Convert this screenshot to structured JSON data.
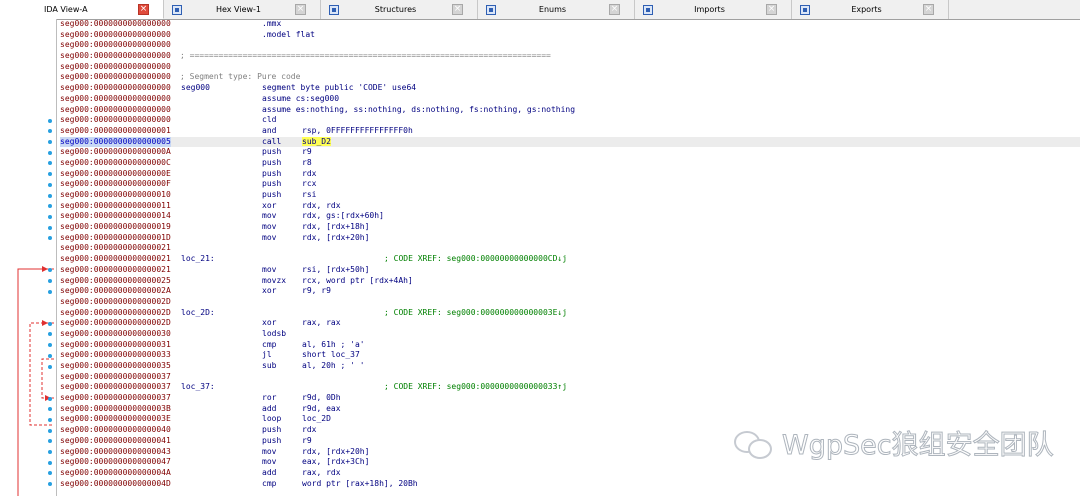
{
  "tabs": [
    {
      "label": "IDA View-A",
      "active": true,
      "icon": "ida-view-icon"
    },
    {
      "label": "Hex View-1",
      "active": false,
      "icon": "hex-view-icon"
    },
    {
      "label": "Structures",
      "active": false,
      "icon": "structures-icon"
    },
    {
      "label": "Enums",
      "active": false,
      "icon": "enums-icon"
    },
    {
      "label": "Imports",
      "active": false,
      "icon": "imports-icon"
    },
    {
      "label": "Exports",
      "active": false,
      "icon": "exports-icon"
    }
  ],
  "close_glyph": "×",
  "colors": {
    "address": "#800000",
    "instruction": "#000080",
    "xref": "#008000",
    "comment": "#808080",
    "highlight": "#ffff55",
    "arrow": "#e03030",
    "dot": "#27a0e0"
  },
  "listing": [
    {
      "addr": "seg000:0000000000000000",
      "label": "",
      "mn": ".mmx",
      "op": ""
    },
    {
      "addr": "seg000:0000000000000000",
      "label": "",
      "mn": ".model flat",
      "op": ""
    },
    {
      "addr": "seg000:0000000000000000",
      "label": "",
      "mn": "",
      "op": ""
    },
    {
      "addr": "seg000:0000000000000000",
      "comment": "; ===========================================================================",
      "mn": "",
      "op": ""
    },
    {
      "addr": "seg000:0000000000000000",
      "label": "",
      "mn": "",
      "op": ""
    },
    {
      "addr": "seg000:0000000000000000",
      "comment": "; Segment type: Pure code",
      "mn": "",
      "op": ""
    },
    {
      "addr": "seg000:0000000000000000",
      "label": "seg000",
      "mn": "segment byte public 'CODE' use64",
      "op": ""
    },
    {
      "addr": "seg000:0000000000000000",
      "label": "",
      "mn": "assume cs:seg000",
      "op": ""
    },
    {
      "addr": "seg000:0000000000000000",
      "label": "",
      "mn": "assume es:nothing, ss:nothing, ds:nothing, fs:nothing, gs:nothing",
      "op": ""
    },
    {
      "addr": "seg000:0000000000000000",
      "label": "",
      "mn": "cld",
      "op": "",
      "dot": true
    },
    {
      "addr": "seg000:0000000000000001",
      "label": "",
      "mn": "and",
      "op": "rsp, 0FFFFFFFFFFFFFFF0h",
      "dot": true
    },
    {
      "addr": "seg000:0000000000000005",
      "label": "",
      "mn": "call",
      "op": "sub_D2",
      "dot": true,
      "selected": true,
      "op_highlight": true
    },
    {
      "addr": "seg000:000000000000000A",
      "label": "",
      "mn": "push",
      "op": "r9",
      "dot": true
    },
    {
      "addr": "seg000:000000000000000C",
      "label": "",
      "mn": "push",
      "op": "r8",
      "dot": true
    },
    {
      "addr": "seg000:000000000000000E",
      "label": "",
      "mn": "push",
      "op": "rdx",
      "dot": true
    },
    {
      "addr": "seg000:000000000000000F",
      "label": "",
      "mn": "push",
      "op": "rcx",
      "dot": true
    },
    {
      "addr": "seg000:0000000000000010",
      "label": "",
      "mn": "push",
      "op": "rsi",
      "dot": true
    },
    {
      "addr": "seg000:0000000000000011",
      "label": "",
      "mn": "xor",
      "op": "rdx, rdx",
      "dot": true
    },
    {
      "addr": "seg000:0000000000000014",
      "label": "",
      "mn": "mov",
      "op": "rdx, gs:[rdx+60h]",
      "dot": true
    },
    {
      "addr": "seg000:0000000000000019",
      "label": "",
      "mn": "mov",
      "op": "rdx, [rdx+18h]",
      "dot": true
    },
    {
      "addr": "seg000:000000000000001D",
      "label": "",
      "mn": "mov",
      "op": "rdx, [rdx+20h]",
      "dot": true
    },
    {
      "addr": "seg000:0000000000000021",
      "label": "",
      "mn": "",
      "op": ""
    },
    {
      "addr": "seg000:0000000000000021",
      "label": "loc_21:",
      "mn": "",
      "op": "",
      "xref": "; CODE XREF: seg000:00000000000000CD↓j"
    },
    {
      "addr": "seg000:0000000000000021",
      "label": "",
      "mn": "mov",
      "op": "rsi, [rdx+50h]",
      "dot": true
    },
    {
      "addr": "seg000:0000000000000025",
      "label": "",
      "mn": "movzx",
      "op": "rcx, word ptr [rdx+4Ah]",
      "dot": true
    },
    {
      "addr": "seg000:000000000000002A",
      "label": "",
      "mn": "xor",
      "op": "r9, r9",
      "dot": true
    },
    {
      "addr": "seg000:000000000000002D",
      "label": "",
      "mn": "",
      "op": ""
    },
    {
      "addr": "seg000:000000000000002D",
      "label": "loc_2D:",
      "mn": "",
      "op": "",
      "xref": "; CODE XREF: seg000:000000000000003E↓j"
    },
    {
      "addr": "seg000:000000000000002D",
      "label": "",
      "mn": "xor",
      "op": "rax, rax",
      "dot": true
    },
    {
      "addr": "seg000:0000000000000030",
      "label": "",
      "mn": "lodsb",
      "op": "",
      "dot": true
    },
    {
      "addr": "seg000:0000000000000031",
      "label": "",
      "mn": "cmp",
      "op": "al, 61h ; 'a'",
      "dot": true
    },
    {
      "addr": "seg000:0000000000000033",
      "label": "",
      "mn": "jl",
      "op": "short loc_37",
      "dot": true
    },
    {
      "addr": "seg000:0000000000000035",
      "label": "",
      "mn": "sub",
      "op": "al, 20h ; ' '",
      "dot": true
    },
    {
      "addr": "seg000:0000000000000037",
      "label": "",
      "mn": "",
      "op": ""
    },
    {
      "addr": "seg000:0000000000000037",
      "label": "loc_37:",
      "mn": "",
      "op": "",
      "xref": "; CODE XREF: seg000:0000000000000033↑j"
    },
    {
      "addr": "seg000:0000000000000037",
      "label": "",
      "mn": "ror",
      "op": "r9d, 0Dh",
      "dot": true
    },
    {
      "addr": "seg000:000000000000003B",
      "label": "",
      "mn": "add",
      "op": "r9d, eax",
      "dot": true
    },
    {
      "addr": "seg000:000000000000003E",
      "label": "",
      "mn": "loop",
      "op": "loc_2D",
      "dot": true
    },
    {
      "addr": "seg000:0000000000000040",
      "label": "",
      "mn": "push",
      "op": "rdx",
      "dot": true
    },
    {
      "addr": "seg000:0000000000000041",
      "label": "",
      "mn": "push",
      "op": "r9",
      "dot": true
    },
    {
      "addr": "seg000:0000000000000043",
      "label": "",
      "mn": "mov",
      "op": "rdx, [rdx+20h]",
      "dot": true
    },
    {
      "addr": "seg000:0000000000000047",
      "label": "",
      "mn": "mov",
      "op": "eax, [rdx+3Ch]",
      "dot": true
    },
    {
      "addr": "seg000:000000000000004A",
      "label": "",
      "mn": "add",
      "op": "rax, rdx",
      "dot": true
    },
    {
      "addr": "seg000:000000000000004D",
      "label": "",
      "mn": "cmp",
      "op": "word ptr [rax+18h], 20Bh",
      "dot": true
    }
  ],
  "watermark": "WgpSec狼组安全团队"
}
